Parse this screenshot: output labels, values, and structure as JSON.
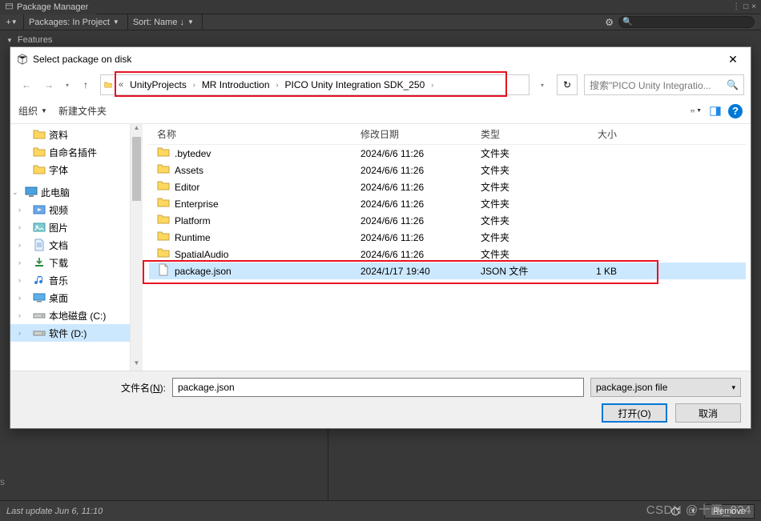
{
  "package_manager": {
    "tab_title": "Package Manager",
    "add_label": "+",
    "packages_dropdown": "Packages: In Project",
    "sort_dropdown": "Sort: Name ↓",
    "section_header": "Features",
    "remove_button": "Remove",
    "status_text": "Last update Jun 6, 11:10"
  },
  "dialog": {
    "title": "Select package on disk",
    "breadcrumb_prefix": "«",
    "breadcrumb": [
      "UnityProjects",
      "MR Introduction",
      "PICO Unity Integration SDK_250"
    ],
    "search_placeholder": "搜索\"PICO Unity Integratio...",
    "organize_label": "组织",
    "new_folder_label": "新建文件夹",
    "columns": {
      "name": "名称",
      "date": "修改日期",
      "type": "类型",
      "size": "大小"
    },
    "tree": {
      "quick": [
        {
          "label": "资料",
          "icon": "folder"
        },
        {
          "label": "自命名插件",
          "icon": "folder"
        },
        {
          "label": "字体",
          "icon": "folder"
        }
      ],
      "this_pc_label": "此电脑",
      "this_pc_children": [
        {
          "label": "视频",
          "icon": "videos"
        },
        {
          "label": "图片",
          "icon": "pictures"
        },
        {
          "label": "文档",
          "icon": "documents"
        },
        {
          "label": "下载",
          "icon": "downloads"
        },
        {
          "label": "音乐",
          "icon": "music"
        },
        {
          "label": "桌面",
          "icon": "desktop"
        },
        {
          "label": "本地磁盘 (C:)",
          "icon": "drive"
        },
        {
          "label": "软件 (D:)",
          "icon": "drive",
          "selected": true
        }
      ]
    },
    "rows": [
      {
        "name": ".bytedev",
        "date": "2024/6/6 11:26",
        "type": "文件夹",
        "size": "",
        "icon": "folder"
      },
      {
        "name": "Assets",
        "date": "2024/6/6 11:26",
        "type": "文件夹",
        "size": "",
        "icon": "folder"
      },
      {
        "name": "Editor",
        "date": "2024/6/6 11:26",
        "type": "文件夹",
        "size": "",
        "icon": "folder"
      },
      {
        "name": "Enterprise",
        "date": "2024/6/6 11:26",
        "type": "文件夹",
        "size": "",
        "icon": "folder"
      },
      {
        "name": "Platform",
        "date": "2024/6/6 11:26",
        "type": "文件夹",
        "size": "",
        "icon": "folder"
      },
      {
        "name": "Runtime",
        "date": "2024/6/6 11:26",
        "type": "文件夹",
        "size": "",
        "icon": "folder"
      },
      {
        "name": "SpatialAudio",
        "date": "2024/6/6 11:26",
        "type": "文件夹",
        "size": "",
        "icon": "folder"
      },
      {
        "name": "package.json",
        "date": "2024/1/17 19:40",
        "type": "JSON 文件",
        "size": "1 KB",
        "icon": "file",
        "selected": true
      }
    ],
    "filename_label_prefix": "文件名(",
    "filename_label_key": "N",
    "filename_label_suffix": "):",
    "filename_value": "package.json",
    "filter_label": "package.json file",
    "open_label": "打开(O)",
    "cancel_label": "取消"
  },
  "watermark": "CSDN @十画_824"
}
